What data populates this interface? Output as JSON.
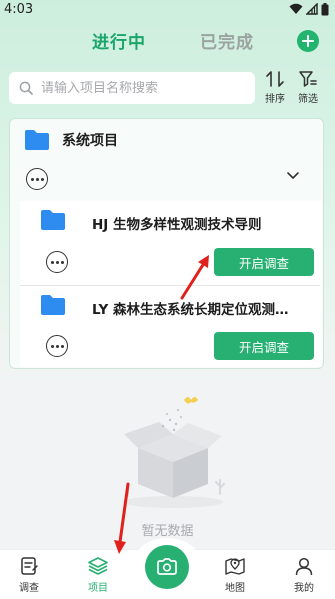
{
  "status_bar": {
    "time": "4:03"
  },
  "tabs": [
    {
      "label": "进行中",
      "active": true
    },
    {
      "label": "已完成",
      "active": false
    }
  ],
  "search": {
    "placeholder": "请输入项目名称搜索",
    "value": ""
  },
  "toolbar": {
    "sort_label": "排序",
    "filter_label": "筛选"
  },
  "group": {
    "title": "系统项目",
    "items": [
      {
        "title": "HJ 生物多样性观测技术导则",
        "button_label": "开启调查"
      },
      {
        "title": "LY 森林生态系统长期定位观测…",
        "button_label": "开启调查"
      }
    ]
  },
  "empty_state": {
    "text": "暂无数据"
  },
  "tabbar": {
    "items": [
      {
        "label": "调查",
        "icon": "survey-icon",
        "active": false
      },
      {
        "label": "项目",
        "icon": "project-layers-icon",
        "active": true
      },
      {
        "label": "地图",
        "icon": "map-pin-icon",
        "active": false
      },
      {
        "label": "我的",
        "icon": "profile-icon",
        "active": false
      }
    ]
  },
  "colors": {
    "accent": "#27b072",
    "tab_active": "#1aa56a",
    "folder": "#2e8cf0",
    "annotation": "#e0201c"
  }
}
